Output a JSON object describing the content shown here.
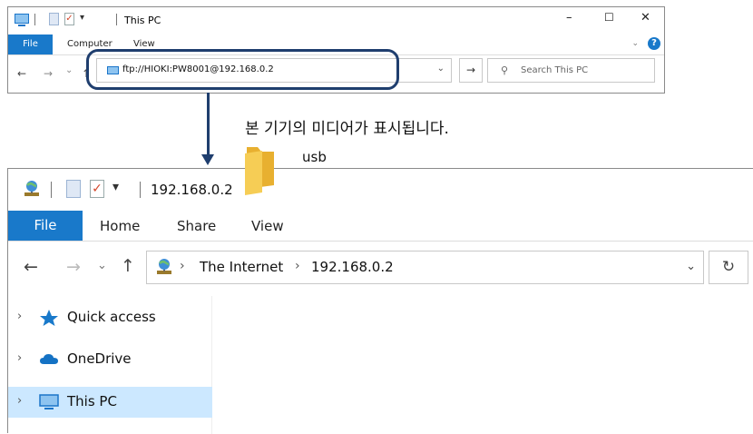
{
  "top_window": {
    "title": "This PC",
    "controls": {
      "minimize": "–",
      "maximize": "☐",
      "close": "✕"
    },
    "ribbon": {
      "file": "File",
      "tabs": [
        "Computer",
        "View"
      ],
      "help": "?"
    },
    "nav": {
      "back": "←",
      "forward": "→",
      "recent": "⌄",
      "up": "↑"
    },
    "address": {
      "value": "ftp://HIOKI:PW8001@192.168.0.2",
      "dropdown": "⌄",
      "go": "→"
    },
    "search": {
      "placeholder": "Search This PC"
    }
  },
  "caption": "본 기기의 미디어가 표시됩니다.",
  "bottom_window": {
    "title": "192.168.0.2",
    "ribbon": {
      "file": "File",
      "tabs": [
        "Home",
        "Share",
        "View"
      ]
    },
    "nav": {
      "back": "←",
      "forward": "→",
      "recent": "⌄",
      "up": "↑"
    },
    "breadcrumb": [
      "The Internet",
      "192.168.0.2"
    ],
    "address_dropdown": "⌄",
    "refresh": "↻",
    "sidebar": [
      {
        "label": "Quick access",
        "icon": "star-icon"
      },
      {
        "label": "OneDrive",
        "icon": "cloud-icon"
      },
      {
        "label": "This PC",
        "icon": "computer-icon",
        "selected": true
      }
    ],
    "items": [
      {
        "label": "usb",
        "icon": "folder-icon"
      }
    ]
  },
  "colors": {
    "accent": "#1979ca",
    "highlight_border": "#1f3e6e",
    "selection": "#cce8ff",
    "folder": "#f4c542"
  }
}
